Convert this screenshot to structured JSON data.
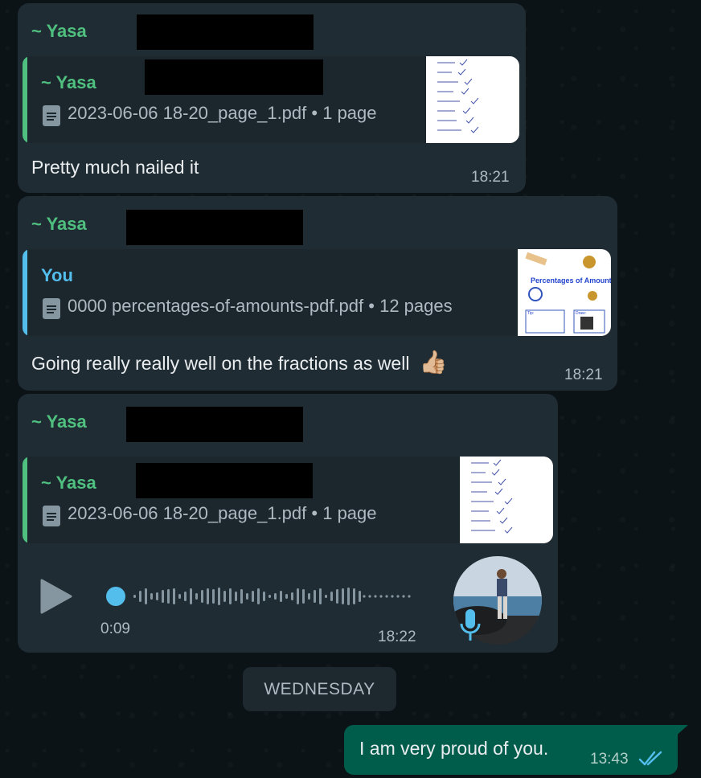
{
  "messages": [
    {
      "sender": "~ Yasa",
      "quote_sender": "~ Yasa",
      "file_name": "2023-06-06 18-20_page_1.pdf",
      "file_meta": "1 page",
      "text": "Pretty much nailed it",
      "time": "18:21"
    },
    {
      "sender": "~ Yasa",
      "quote_sender": "You",
      "file_name": "0000 percentages-of-amounts-pdf.pdf",
      "file_meta": "12 pages",
      "text": "Going really really well on the fractions as well",
      "emoji": "👍🏼",
      "thumb_title": "Percentages of Amounts",
      "thumb_tip_label": "Tip:",
      "thumb_draw_label": "Draw:",
      "time": "18:21"
    },
    {
      "sender": "~ Yasa",
      "quote_sender": "~ Yasa",
      "file_name": "2023-06-06 18-20_page_1.pdf",
      "file_meta": "1 page",
      "voice_duration": "0:09",
      "voice_progress": 0.0,
      "time": "18:22"
    }
  ],
  "day_divider": "WEDNESDAY",
  "outgoing": {
    "text": "I am very proud of you.",
    "time": "13:43",
    "status": "read"
  },
  "colors": {
    "incoming_bubble": "#202c33",
    "outgoing_bubble": "#005c4b",
    "sender_green": "#4fc07f",
    "you_blue": "#53bdeb",
    "read_tick": "#53bdeb"
  },
  "icons": {
    "document": "doc-icon",
    "play": "play-icon",
    "mic": "mic-icon",
    "read_receipt": "double-check-icon"
  }
}
